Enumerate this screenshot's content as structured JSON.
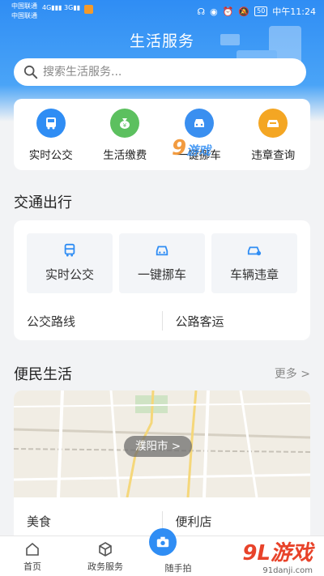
{
  "statusbar": {
    "carrier1": "中国联通",
    "carrier2": "中国联通",
    "network1": "4G",
    "network2": "3G",
    "battery": "50",
    "time": "中午11:24"
  },
  "header": {
    "title": "生活服务"
  },
  "search": {
    "placeholder": "搜索生活服务..."
  },
  "quick_services": [
    {
      "label": "实时公交",
      "icon": "bus-icon",
      "color": "#2f8df4"
    },
    {
      "label": "生活缴费",
      "icon": "money-bag-icon",
      "color": "#5cc05f"
    },
    {
      "label": "一键挪车",
      "icon": "car-front-icon",
      "color": "#3a8ff0"
    },
    {
      "label": "违章查询",
      "icon": "car-alert-icon",
      "color": "#f4a623"
    }
  ],
  "traffic": {
    "title": "交通出行",
    "tiles": [
      {
        "label": "实时公交",
        "icon": "bus-icon"
      },
      {
        "label": "一键挪车",
        "icon": "car-front-icon"
      },
      {
        "label": "车辆违章",
        "icon": "car-alert-icon"
      }
    ],
    "links": [
      "公交路线",
      "公路客运"
    ]
  },
  "life": {
    "title": "便民生活",
    "more": "更多 >",
    "city": "濮阳市 >",
    "links": [
      "美食",
      "便利店"
    ]
  },
  "tabbar": {
    "tabs": [
      {
        "label": "首页",
        "icon": "home-icon"
      },
      {
        "label": "政务服务",
        "icon": "cube-icon"
      },
      {
        "label": "随手拍",
        "icon": "camera-icon"
      }
    ]
  },
  "watermark": {
    "middle_91": "9",
    "middle_text": "游戏",
    "brand": "9L游戏",
    "url": "91danji.com"
  },
  "colors": {
    "primary": "#2f8df4",
    "background": "#f2f3f5"
  }
}
